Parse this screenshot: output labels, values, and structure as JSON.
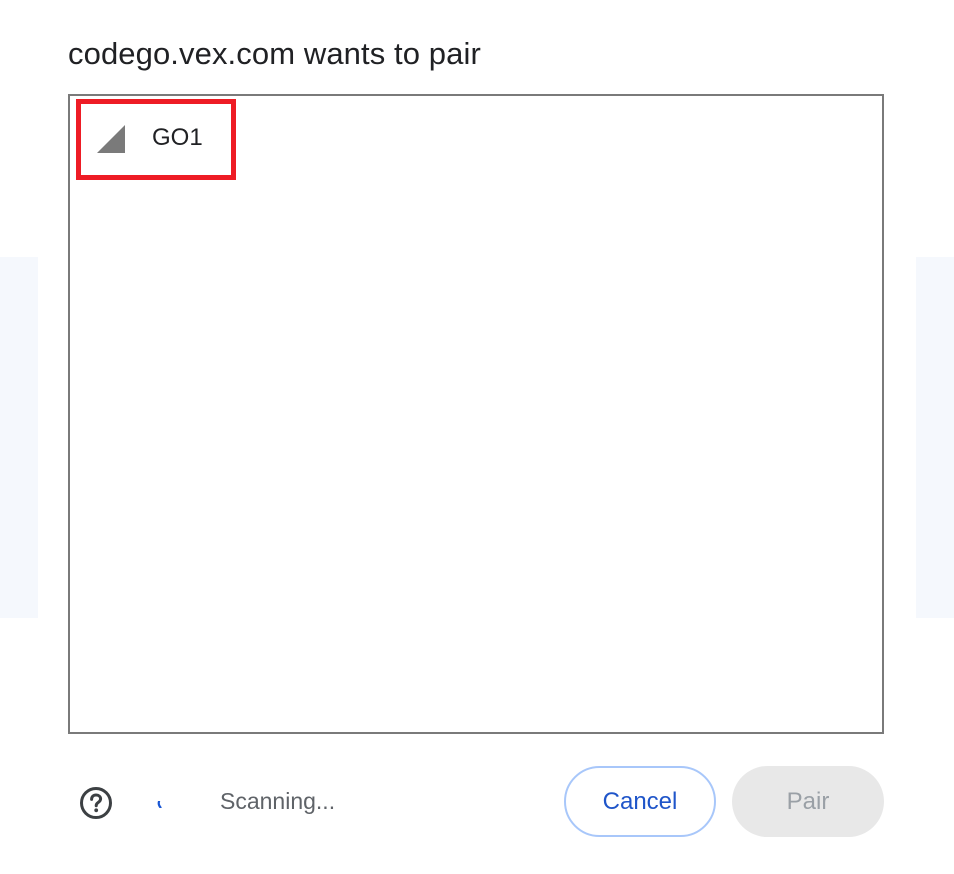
{
  "dialog": {
    "title": "codego.vex.com wants to pair"
  },
  "device_list": {
    "items": [
      {
        "name": "GO1",
        "icon": "signal-strength-icon",
        "highlighted": true
      }
    ]
  },
  "footer": {
    "help_icon": "help-circle-icon",
    "status_text": "Scanning...",
    "cancel_label": "Cancel",
    "pair_label": "Pair",
    "pair_enabled": false
  },
  "colors": {
    "highlight_border": "#ee1c25",
    "accent_text": "#1f55c9",
    "cancel_border": "#a8c7fa",
    "disabled_bg": "#e8e8e8",
    "disabled_text": "#9aa0a6"
  }
}
